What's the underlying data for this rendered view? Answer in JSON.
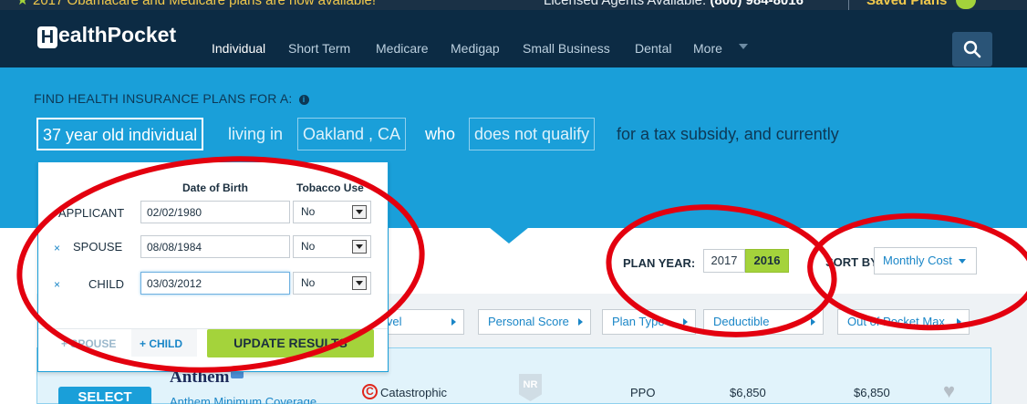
{
  "promo": {
    "message": "2017 Obamacare and Medicare plans are now available!",
    "agents_label": "Licensed Agents Available:",
    "agents_phone": "(800) 984-8016",
    "saved_plans": "Saved Plans"
  },
  "nav": {
    "logo_letter": "H",
    "logo_text": "ealthPocket",
    "items": [
      "Individual",
      "Short Term",
      "Medicare",
      "Medigap",
      "Small Business",
      "Dental",
      "More"
    ]
  },
  "hero": {
    "title": "FIND HEALTH INSURANCE PLANS FOR A:",
    "info_icon": "i",
    "household": "37 year old individual",
    "living_in": "living in",
    "location": "Oakland , CA",
    "who": "who",
    "subsidy": "does not qualify",
    "suffix": "for a tax subsidy, and currently"
  },
  "panel": {
    "col_dob": "Date of Birth",
    "col_tobacco": "Tobacco Use",
    "rows": [
      {
        "label": "APPLICANT",
        "dob": "02/02/1980",
        "tobacco": "No",
        "removable": false
      },
      {
        "label": "SPOUSE",
        "dob": "08/08/1984",
        "tobacco": "No",
        "removable": true
      },
      {
        "label": "CHILD",
        "dob": "03/03/2012",
        "tobacco": "No",
        "removable": true
      }
    ],
    "remove_symbol": "×",
    "add_spouse": "+ SPOUSE",
    "add_child": "+ CHILD",
    "update": "UPDATE RESULTS"
  },
  "plan_year": {
    "label": "PLAN YEAR:",
    "options": [
      "2017",
      "2016"
    ],
    "selected": "2016"
  },
  "sort": {
    "label": "SORT BY:",
    "value": "Monthly Cost"
  },
  "filters": [
    "Metal Level",
    "Personal Score",
    "Plan Type",
    "Deductible",
    "Out of Pocket Max"
  ],
  "plan": {
    "select": "SELECT",
    "carrier": "Anthem",
    "name": "Anthem Minimum Coverage",
    "metal_icon": "C",
    "metal": "Catastrophic",
    "score": "NR",
    "type": "PPO",
    "deductible": "$6,850",
    "oop_max": "$6,850"
  },
  "colors": {
    "nav_bg": "#0c2b44",
    "hero_bg": "#1a9fd9",
    "accent_green": "#a4d33b",
    "link_blue": "#1a86c7",
    "annotation_red": "#e3000f"
  },
  "icons": [
    "star-icon",
    "search-icon",
    "info-icon",
    "caret-down-icon",
    "heart-icon",
    "catastrophic-icon",
    "score-badge-icon"
  ]
}
